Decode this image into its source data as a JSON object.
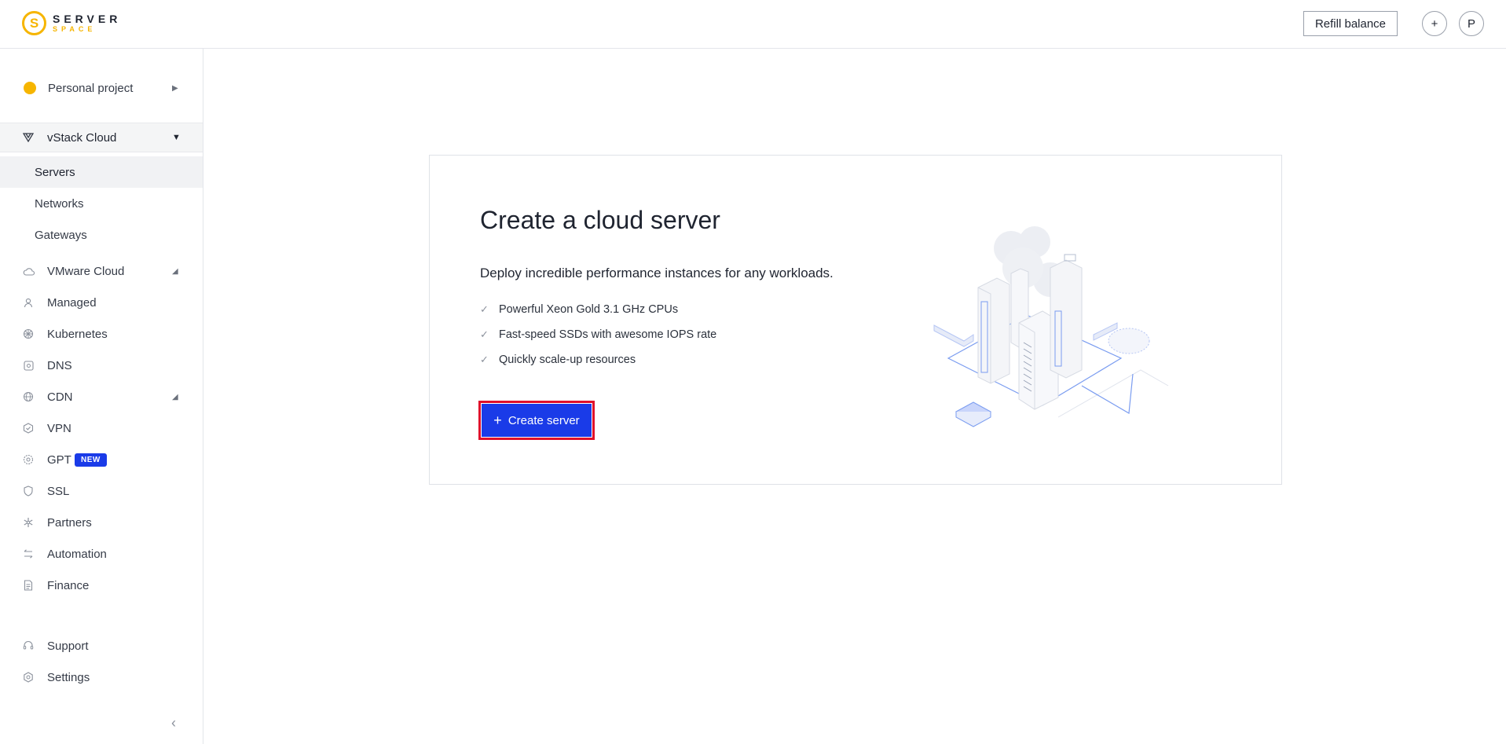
{
  "header": {
    "logo_line1": "SERVER",
    "logo_line2": "SPACE",
    "refill_label": "Refill balance",
    "plus_icon": "+",
    "avatar_letter": "P"
  },
  "sidebar": {
    "project": "Personal project",
    "vstack": "vStack Cloud",
    "vstack_sub": [
      "Servers",
      "Networks",
      "Gateways"
    ],
    "items": [
      {
        "label": "VMware Cloud",
        "icon": "cloud-icon"
      },
      {
        "label": "Managed",
        "icon": "user-icon"
      },
      {
        "label": "Kubernetes",
        "icon": "helm-icon"
      },
      {
        "label": "DNS",
        "icon": "dns-icon"
      },
      {
        "label": "CDN",
        "icon": "globe-icon"
      },
      {
        "label": "VPN",
        "icon": "shield-check-icon"
      },
      {
        "label": "GPT",
        "icon": "chip-icon"
      },
      {
        "label": "SSL",
        "icon": "shield-icon"
      },
      {
        "label": "Partners",
        "icon": "asterisk-icon"
      },
      {
        "label": "Automation",
        "icon": "arrows-icon"
      },
      {
        "label": "Finance",
        "icon": "document-icon"
      }
    ],
    "gpt_badge": "NEW",
    "support": "Support",
    "settings": "Settings"
  },
  "main": {
    "title": "Create a cloud server",
    "subtitle": "Deploy incredible performance instances for any workloads.",
    "features": [
      "Powerful Xeon Gold 3.1 GHz CPUs",
      "Fast-speed SSDs with awesome IOPS rate",
      "Quickly scale-up resources"
    ],
    "create_button": "Create server"
  },
  "colors": {
    "accent": "#1a3be8",
    "brand_yellow": "#f6b500",
    "highlight": "#e0102b"
  }
}
